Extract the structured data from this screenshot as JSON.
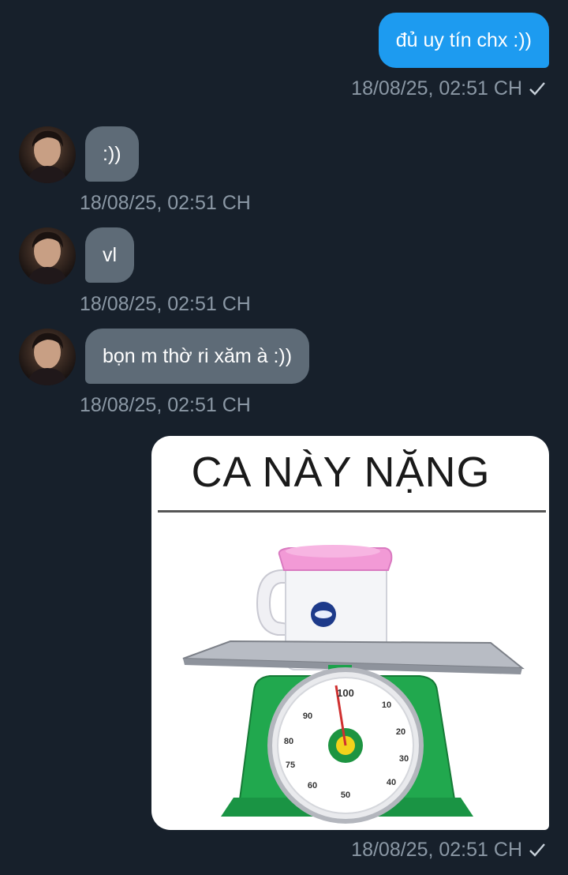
{
  "messages": [
    {
      "direction": "outgoing",
      "text": "đủ uy tín chx :))",
      "timestamp": "18/08/25, 02:51 CH",
      "read": true
    },
    {
      "direction": "incoming",
      "text": ":))",
      "timestamp": "18/08/25, 02:51 CH"
    },
    {
      "direction": "incoming",
      "text": "vl",
      "timestamp": "18/08/25, 02:51 CH"
    },
    {
      "direction": "incoming",
      "text": "bọn m thờ ri xăm à :))",
      "timestamp": "18/08/25, 02:51 CH"
    },
    {
      "direction": "outgoing",
      "type": "image",
      "image_caption": "CA NÀY NẶNG",
      "timestamp": "18/08/25, 02:51 CH",
      "read": true
    }
  ],
  "scale_dial": {
    "labels": [
      "100",
      "10",
      "20",
      "30",
      "40",
      "50",
      "60",
      "75",
      "80",
      "90"
    ]
  },
  "colors": {
    "background": "#17202b",
    "outgoing_bubble": "#1d9bf0",
    "incoming_bubble": "#5e6b77",
    "timestamp": "#8b98a5"
  },
  "icons": {
    "read_receipt": "checkmark-icon",
    "avatar": "avatar"
  }
}
